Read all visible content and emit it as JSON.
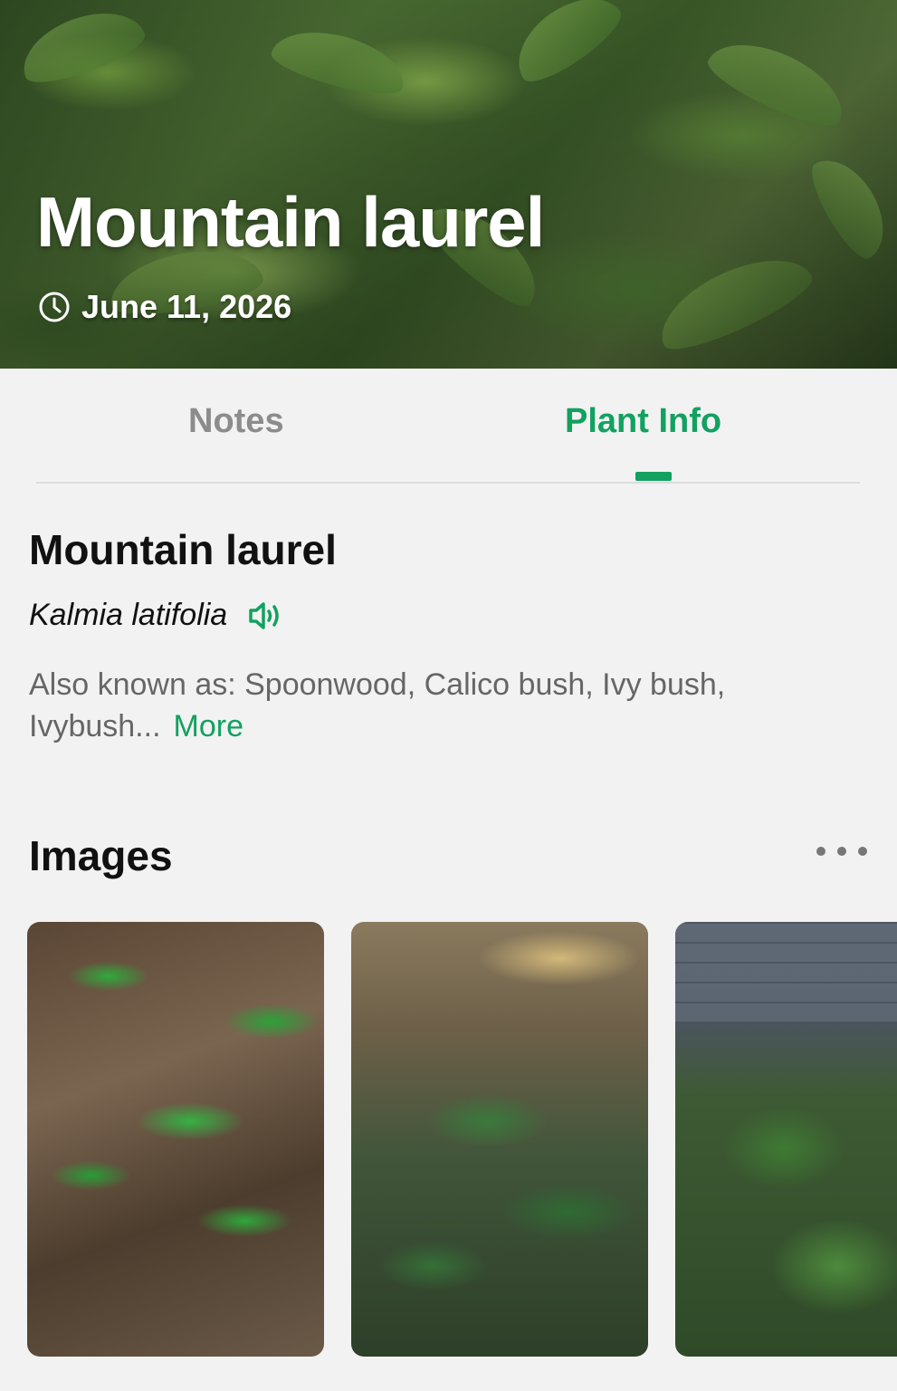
{
  "hero": {
    "title": "Mountain laurel",
    "date": "June 11, 2026"
  },
  "tabs": [
    {
      "label": "Notes",
      "active": false
    },
    {
      "label": "Plant Info",
      "active": true
    }
  ],
  "plant": {
    "common_name": "Mountain laurel",
    "scientific_name": "Kalmia latifolia",
    "aka_text": "Also known as: Spoonwood, Calico bush, Ivy bush, Ivybush...",
    "more_label": "More"
  },
  "images_section": {
    "title": "Images",
    "thumbnails": [
      "thumb-1",
      "thumb-2",
      "thumb-3"
    ]
  },
  "colors": {
    "accent": "#12a160",
    "inactive_tab": "#8c8c8c",
    "background": "#f2f2f2"
  },
  "icons": [
    "clock-icon",
    "speaker-icon",
    "more-dots-icon"
  ]
}
